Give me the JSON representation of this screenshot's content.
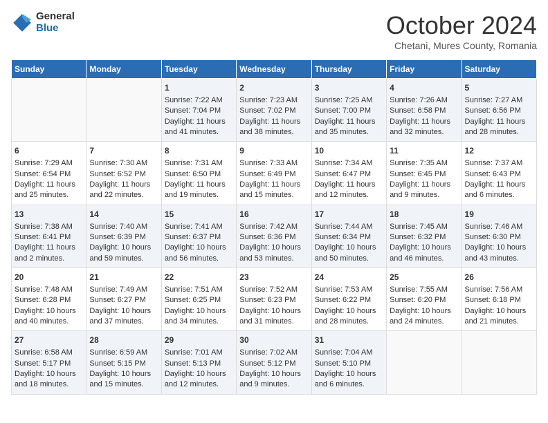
{
  "header": {
    "logo_general": "General",
    "logo_blue": "Blue",
    "month_title": "October 2024",
    "location": "Chetani, Mures County, Romania"
  },
  "days_of_week": [
    "Sunday",
    "Monday",
    "Tuesday",
    "Wednesday",
    "Thursday",
    "Friday",
    "Saturday"
  ],
  "weeks": [
    [
      {
        "day": "",
        "sunrise": "",
        "sunset": "",
        "daylight": ""
      },
      {
        "day": "",
        "sunrise": "",
        "sunset": "",
        "daylight": ""
      },
      {
        "day": "1",
        "sunrise": "Sunrise: 7:22 AM",
        "sunset": "Sunset: 7:04 PM",
        "daylight": "Daylight: 11 hours and 41 minutes."
      },
      {
        "day": "2",
        "sunrise": "Sunrise: 7:23 AM",
        "sunset": "Sunset: 7:02 PM",
        "daylight": "Daylight: 11 hours and 38 minutes."
      },
      {
        "day": "3",
        "sunrise": "Sunrise: 7:25 AM",
        "sunset": "Sunset: 7:00 PM",
        "daylight": "Daylight: 11 hours and 35 minutes."
      },
      {
        "day": "4",
        "sunrise": "Sunrise: 7:26 AM",
        "sunset": "Sunset: 6:58 PM",
        "daylight": "Daylight: 11 hours and 32 minutes."
      },
      {
        "day": "5",
        "sunrise": "Sunrise: 7:27 AM",
        "sunset": "Sunset: 6:56 PM",
        "daylight": "Daylight: 11 hours and 28 minutes."
      }
    ],
    [
      {
        "day": "6",
        "sunrise": "Sunrise: 7:29 AM",
        "sunset": "Sunset: 6:54 PM",
        "daylight": "Daylight: 11 hours and 25 minutes."
      },
      {
        "day": "7",
        "sunrise": "Sunrise: 7:30 AM",
        "sunset": "Sunset: 6:52 PM",
        "daylight": "Daylight: 11 hours and 22 minutes."
      },
      {
        "day": "8",
        "sunrise": "Sunrise: 7:31 AM",
        "sunset": "Sunset: 6:50 PM",
        "daylight": "Daylight: 11 hours and 19 minutes."
      },
      {
        "day": "9",
        "sunrise": "Sunrise: 7:33 AM",
        "sunset": "Sunset: 6:49 PM",
        "daylight": "Daylight: 11 hours and 15 minutes."
      },
      {
        "day": "10",
        "sunrise": "Sunrise: 7:34 AM",
        "sunset": "Sunset: 6:47 PM",
        "daylight": "Daylight: 11 hours and 12 minutes."
      },
      {
        "day": "11",
        "sunrise": "Sunrise: 7:35 AM",
        "sunset": "Sunset: 6:45 PM",
        "daylight": "Daylight: 11 hours and 9 minutes."
      },
      {
        "day": "12",
        "sunrise": "Sunrise: 7:37 AM",
        "sunset": "Sunset: 6:43 PM",
        "daylight": "Daylight: 11 hours and 6 minutes."
      }
    ],
    [
      {
        "day": "13",
        "sunrise": "Sunrise: 7:38 AM",
        "sunset": "Sunset: 6:41 PM",
        "daylight": "Daylight: 11 hours and 2 minutes."
      },
      {
        "day": "14",
        "sunrise": "Sunrise: 7:40 AM",
        "sunset": "Sunset: 6:39 PM",
        "daylight": "Daylight: 10 hours and 59 minutes."
      },
      {
        "day": "15",
        "sunrise": "Sunrise: 7:41 AM",
        "sunset": "Sunset: 6:37 PM",
        "daylight": "Daylight: 10 hours and 56 minutes."
      },
      {
        "day": "16",
        "sunrise": "Sunrise: 7:42 AM",
        "sunset": "Sunset: 6:36 PM",
        "daylight": "Daylight: 10 hours and 53 minutes."
      },
      {
        "day": "17",
        "sunrise": "Sunrise: 7:44 AM",
        "sunset": "Sunset: 6:34 PM",
        "daylight": "Daylight: 10 hours and 50 minutes."
      },
      {
        "day": "18",
        "sunrise": "Sunrise: 7:45 AM",
        "sunset": "Sunset: 6:32 PM",
        "daylight": "Daylight: 10 hours and 46 minutes."
      },
      {
        "day": "19",
        "sunrise": "Sunrise: 7:46 AM",
        "sunset": "Sunset: 6:30 PM",
        "daylight": "Daylight: 10 hours and 43 minutes."
      }
    ],
    [
      {
        "day": "20",
        "sunrise": "Sunrise: 7:48 AM",
        "sunset": "Sunset: 6:28 PM",
        "daylight": "Daylight: 10 hours and 40 minutes."
      },
      {
        "day": "21",
        "sunrise": "Sunrise: 7:49 AM",
        "sunset": "Sunset: 6:27 PM",
        "daylight": "Daylight: 10 hours and 37 minutes."
      },
      {
        "day": "22",
        "sunrise": "Sunrise: 7:51 AM",
        "sunset": "Sunset: 6:25 PM",
        "daylight": "Daylight: 10 hours and 34 minutes."
      },
      {
        "day": "23",
        "sunrise": "Sunrise: 7:52 AM",
        "sunset": "Sunset: 6:23 PM",
        "daylight": "Daylight: 10 hours and 31 minutes."
      },
      {
        "day": "24",
        "sunrise": "Sunrise: 7:53 AM",
        "sunset": "Sunset: 6:22 PM",
        "daylight": "Daylight: 10 hours and 28 minutes."
      },
      {
        "day": "25",
        "sunrise": "Sunrise: 7:55 AM",
        "sunset": "Sunset: 6:20 PM",
        "daylight": "Daylight: 10 hours and 24 minutes."
      },
      {
        "day": "26",
        "sunrise": "Sunrise: 7:56 AM",
        "sunset": "Sunset: 6:18 PM",
        "daylight": "Daylight: 10 hours and 21 minutes."
      }
    ],
    [
      {
        "day": "27",
        "sunrise": "Sunrise: 6:58 AM",
        "sunset": "Sunset: 5:17 PM",
        "daylight": "Daylight: 10 hours and 18 minutes."
      },
      {
        "day": "28",
        "sunrise": "Sunrise: 6:59 AM",
        "sunset": "Sunset: 5:15 PM",
        "daylight": "Daylight: 10 hours and 15 minutes."
      },
      {
        "day": "29",
        "sunrise": "Sunrise: 7:01 AM",
        "sunset": "Sunset: 5:13 PM",
        "daylight": "Daylight: 10 hours and 12 minutes."
      },
      {
        "day": "30",
        "sunrise": "Sunrise: 7:02 AM",
        "sunset": "Sunset: 5:12 PM",
        "daylight": "Daylight: 10 hours and 9 minutes."
      },
      {
        "day": "31",
        "sunrise": "Sunrise: 7:04 AM",
        "sunset": "Sunset: 5:10 PM",
        "daylight": "Daylight: 10 hours and 6 minutes."
      },
      {
        "day": "",
        "sunrise": "",
        "sunset": "",
        "daylight": ""
      },
      {
        "day": "",
        "sunrise": "",
        "sunset": "",
        "daylight": ""
      }
    ]
  ]
}
